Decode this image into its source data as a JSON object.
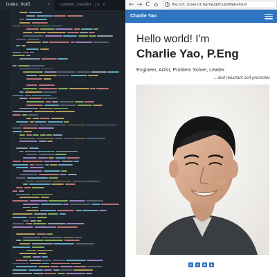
{
  "editor": {
    "tabs": [
      {
        "label": "index.html",
        "active": true
      },
      {
        "label": "common_header.js",
        "active": false
      }
    ]
  },
  "browser": {
    "nav": {
      "back": "←",
      "forward": "→",
      "reload": "C",
      "home": "⌂"
    },
    "url": "file:///C:/Users/Charlie/github/Website/ir"
  },
  "site": {
    "brand": "Charlie Yao",
    "hello": "Hello world! I'm",
    "name": "Charlie Yao, P.Eng",
    "roles": "Engineer, Artist, Problem Solver, Leader",
    "reluctant": "...and reluctant self-promoter.",
    "social": [
      {
        "icon": "phone-square-icon",
        "color": "#2f74c0"
      },
      {
        "icon": "envelope-square-icon",
        "color": "#2f74c0"
      },
      {
        "icon": "linkedin-icon",
        "color": "#2f74c0"
      },
      {
        "icon": "github-icon",
        "color": "#2f74c0"
      }
    ]
  },
  "colors": {
    "navbar": "#2f74c0",
    "editor_bg": "#1e252d"
  }
}
